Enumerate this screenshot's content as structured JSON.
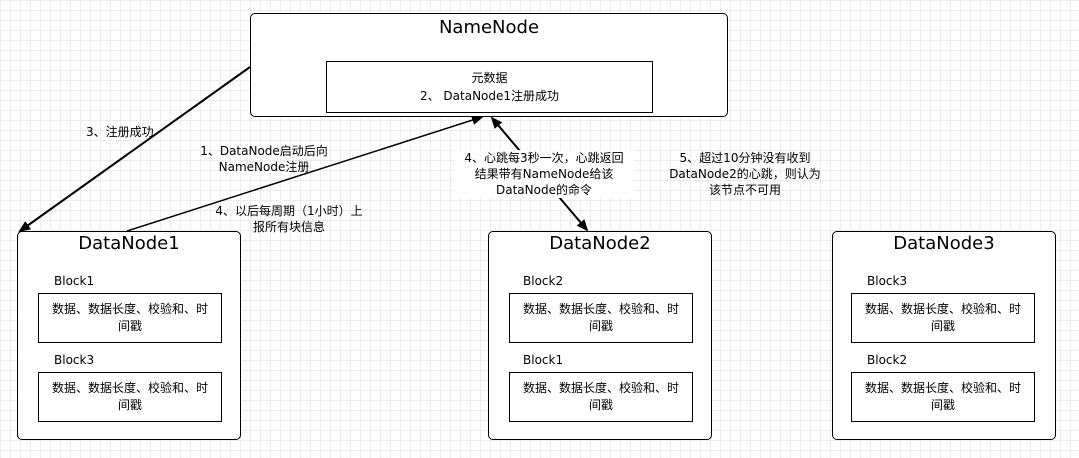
{
  "namenode": {
    "title": "NameNode",
    "meta_line1": "元数据",
    "meta_line2": "2、 DataNode1注册成功"
  },
  "datanodes": [
    {
      "title": "DataNode1",
      "blocks": [
        {
          "label": "Block1",
          "content": "数据、数据长度、校验和、时间戳"
        },
        {
          "label": "Block3",
          "content": "数据、数据长度、校验和、时间戳"
        }
      ]
    },
    {
      "title": "DataNode2",
      "blocks": [
        {
          "label": "Block2",
          "content": "数据、数据长度、校验和、时间戳"
        },
        {
          "label": "Block1",
          "content": "数据、数据长度、校验和、时间戳"
        }
      ]
    },
    {
      "title": "DataNode3",
      "blocks": [
        {
          "label": "Block3",
          "content": "数据、数据长度、校验和、时间戳"
        },
        {
          "label": "Block2",
          "content": "数据、数据长度、校验和、时间戳"
        }
      ]
    }
  ],
  "edges": {
    "register_success": "3、注册成功",
    "register_l1": "1、DataNode启动后向",
    "register_l2": "NameNode注册",
    "report_l1": "4、以后每周期（1小时）上",
    "report_l2": "报所有块信息",
    "heartbeat_l1": "4、心跳每3秒一次，心跳返回",
    "heartbeat_l2": "结果带有NameNode给该",
    "heartbeat_l3": "DataNode的命令",
    "timeout_l1": "5、超过10分钟没有收到",
    "timeout_l2": "DataNode2的心跳，则认为",
    "timeout_l3": "该节点不可用"
  }
}
